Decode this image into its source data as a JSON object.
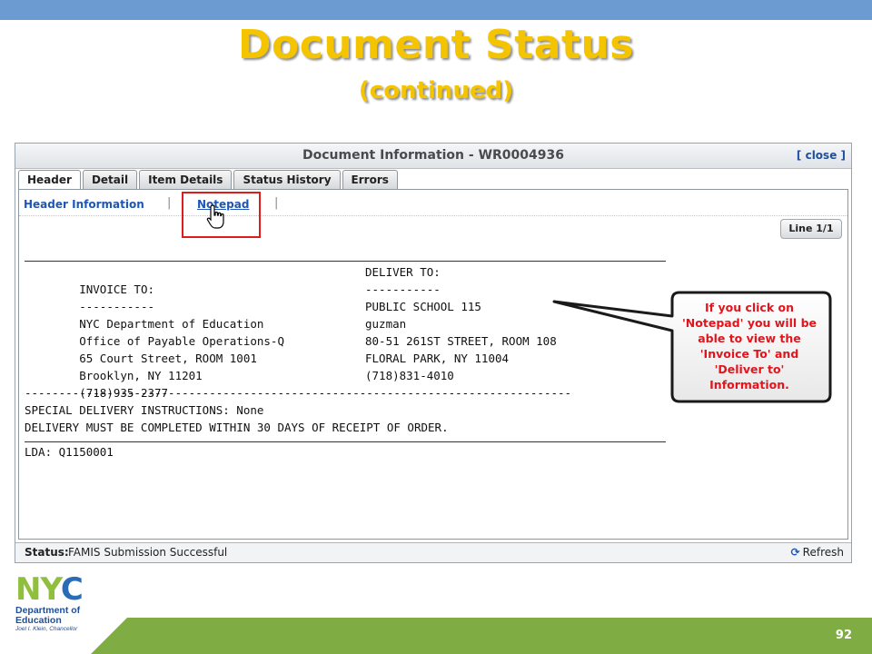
{
  "slide": {
    "title": "Document Status",
    "subtitle": "(continued)",
    "page_number": "92"
  },
  "window": {
    "title": "Document Information - WR0004936",
    "close_label": "[ close ]"
  },
  "tabs": [
    {
      "label": "Header",
      "active": true
    },
    {
      "label": "Detail",
      "active": false
    },
    {
      "label": "Item Details",
      "active": false
    },
    {
      "label": "Status History",
      "active": false
    },
    {
      "label": "Errors",
      "active": false
    }
  ],
  "subnav": {
    "header_info": "Header Information",
    "separator": "|",
    "notepad": "Notepad"
  },
  "line_indicator": "Line 1/1",
  "notepad": {
    "invoice_heading": "INVOICE TO:",
    "deliver_heading": "DELIVER TO:",
    "underline": "-----------",
    "invoice_lines": [
      "NYC Department of Education",
      "Office of Payable Operations-Q",
      "65 Court Street, ROOM 1001",
      "Brooklyn, NY 11201",
      "(718)935-2377"
    ],
    "deliver_lines": [
      "PUBLIC SCHOOL 115",
      "guzman",
      "80-51 261ST STREET, ROOM 108",
      "FLORAL PARK, NY 11004",
      "(718)831-4010"
    ],
    "dash_line": "--------------------------------------------------------------------------------",
    "special_instructions": "SPECIAL DELIVERY INSTRUCTIONS: None",
    "delivery_note": "DELIVERY MUST BE COMPLETED WITHIN 30 DAYS OF RECEIPT OF ORDER.",
    "lda": "LDA: Q1150001"
  },
  "status_bar": {
    "label": "Status:",
    "text": "FAMIS Submission Successful",
    "refresh_label": "Refresh",
    "refresh_icon": "refresh-icon"
  },
  "callout": {
    "lines": [
      "If you click on",
      "'Notepad' you will be",
      "able to view the",
      "'Invoice To' and",
      "'Deliver to'",
      "Information."
    ]
  },
  "logo": {
    "mark_n": "NY",
    "mark_c": "C",
    "line1": "Department of",
    "line2": "Education",
    "chancellor": "Joel I. Klein, Chancellor"
  },
  "colors": {
    "title_yellow": "#f5c400",
    "top_bar_blue": "#6b9bd1",
    "footer_green": "#7fad44",
    "highlight_red": "#e01b1b",
    "link_blue": "#1f56b5"
  }
}
